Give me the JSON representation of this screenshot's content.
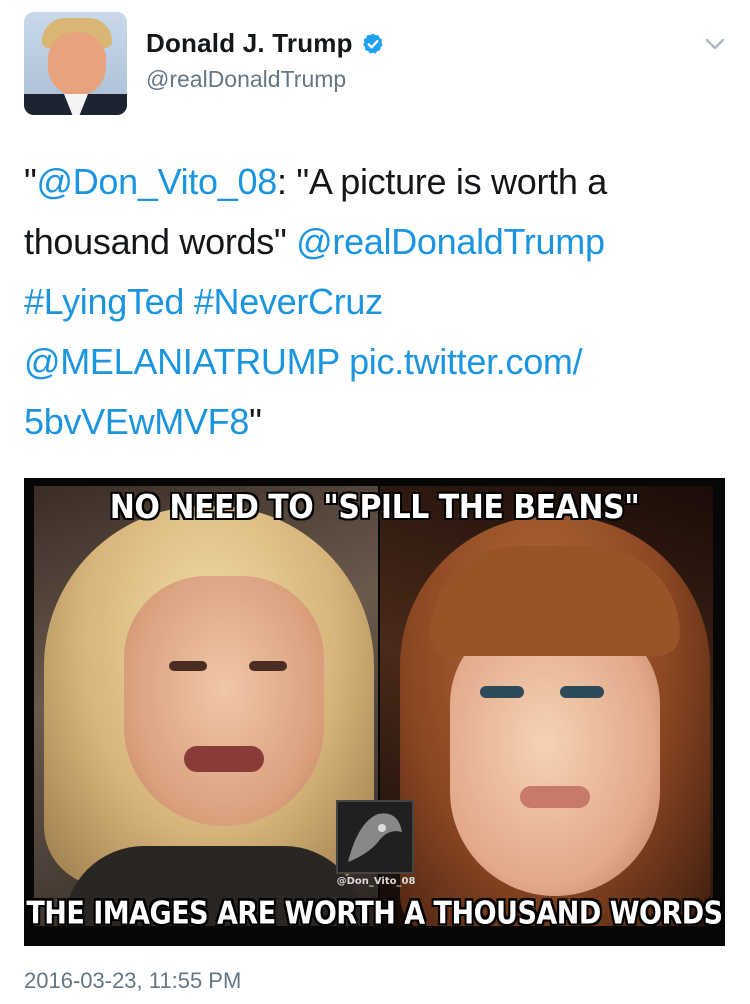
{
  "user": {
    "display_name": "Donald J. Trump",
    "handle": "@realDonaldTrump",
    "verified": true
  },
  "tweet": {
    "line1_prefix": "\"",
    "line1_mention": "@Don_Vito_08",
    "line1_text": ": \"A picture is worth a",
    "line2_text": "thousand words\" ",
    "line2_mention": "@realDonaldTrump",
    "hashtag1": "#LyingTed",
    "hashtag2": "#NeverCruz",
    "mention3": "@MELANIATRUMP",
    "link_part1": "pic.twitter.com/",
    "link_part2": "5bvVEwMVF8",
    "closing_quote": "\""
  },
  "media": {
    "caption_top": "NO NEED TO \"SPILL THE BEANS\"",
    "caption_bottom": "THE IMAGES ARE WORTH A THOUSAND WORDS",
    "watermark": "@Don_Vito_08"
  },
  "timestamp": "2016-03-23, 11:55 PM",
  "colors": {
    "link": "#1b95e0",
    "text": "#14171a",
    "secondary": "#657786",
    "verified": "#1da1f2"
  },
  "icons": {
    "verified": "verified-badge-icon",
    "menu": "chevron-down-icon"
  }
}
